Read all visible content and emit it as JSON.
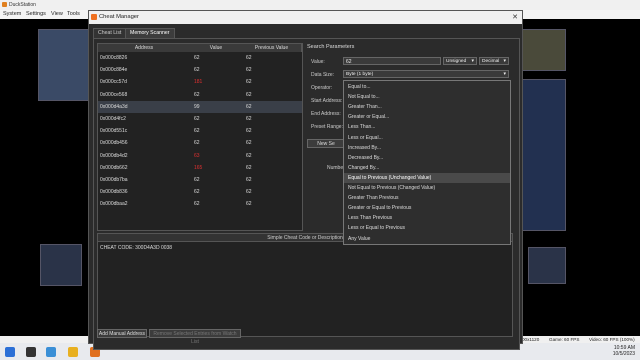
{
  "app": {
    "title": "DuckStation",
    "menu": [
      "System",
      "Settings",
      "View",
      "Tools"
    ]
  },
  "window": {
    "title": "Cheat Manager",
    "close": "✕"
  },
  "tabs": [
    "Cheat List",
    "Memory Scanner"
  ],
  "table": {
    "columns": [
      "Address",
      "Value",
      "Previous Value"
    ],
    "rows": [
      {
        "address": "0x000c8826",
        "value": "62",
        "previous": "62",
        "changed": false
      },
      {
        "address": "0x000c884e",
        "value": "62",
        "previous": "62",
        "changed": false
      },
      {
        "address": "0x000cc57d",
        "value": "181",
        "previous": "62",
        "changed": true
      },
      {
        "address": "0x000ce568",
        "value": "62",
        "previous": "62",
        "changed": false
      },
      {
        "address": "0x000d4a3d",
        "value": "99",
        "previous": "62",
        "changed": false
      },
      {
        "address": "0x000d4fc2",
        "value": "62",
        "previous": "62",
        "changed": false
      },
      {
        "address": "0x000d551c",
        "value": "62",
        "previous": "62",
        "changed": false
      },
      {
        "address": "0x000db456",
        "value": "62",
        "previous": "62",
        "changed": false
      },
      {
        "address": "0x000db4d2",
        "value": "63",
        "previous": "62",
        "changed": true
      },
      {
        "address": "0x000db662",
        "value": "165",
        "previous": "62",
        "changed": true
      },
      {
        "address": "0x000db7ba",
        "value": "62",
        "previous": "62",
        "changed": false
      },
      {
        "address": "0x000db836",
        "value": "62",
        "previous": "62",
        "changed": false
      },
      {
        "address": "0x000dbaa2",
        "value": "62",
        "previous": "62",
        "changed": false
      }
    ]
  },
  "search": {
    "section_title": "Search Parameters",
    "value_label": "Value:",
    "value": "62",
    "signed": "Unsigned",
    "base": "Decimal",
    "data_size_label": "Data Size:",
    "data_size": "Byte (1 byte)",
    "operator_label": "Operator:",
    "start_address_label": "Start Address:",
    "end_address_label": "End Address:",
    "preset_range_label": "Preset Range:",
    "new_search_button": "New Se",
    "number_label": "Number"
  },
  "operator_options": [
    "Equal to...",
    "Not Equal to...",
    "Greater Than...",
    "Greater or Equal...",
    "Less Than...",
    "Less or Equal...",
    "Increased By...",
    "Decreased By...",
    "Changed By...",
    "Equal to Previous (Unchanged Value)",
    "Not Equal to Previous (Changed Value)",
    "Greater Than Previous",
    "Greater or Equal to Previous",
    "Less Than Previous",
    "Less or Equal to Previous",
    "Any Value"
  ],
  "operator_highlighted_index": 9,
  "cheat_code": {
    "header": "Simple Cheat Code or Description",
    "text": "CHEAT CODE: 300D4A3D 0038"
  },
  "buttons": {
    "add_manual": "Add Manual Address",
    "remove_selected": "Remove Selected Entries from Watch List"
  },
  "game_status": {
    "resolution": "00x1120",
    "game_fps": "Game: 60 FPS",
    "video_fps": "Video: 60 FPS (100%)"
  },
  "taskbar": {
    "time": "10:59 AM",
    "date": "10/5/2023"
  },
  "colors": {
    "changed_value": "#e03030",
    "window_bg": "#2b2b2b",
    "selection": "#4a4a4a"
  }
}
